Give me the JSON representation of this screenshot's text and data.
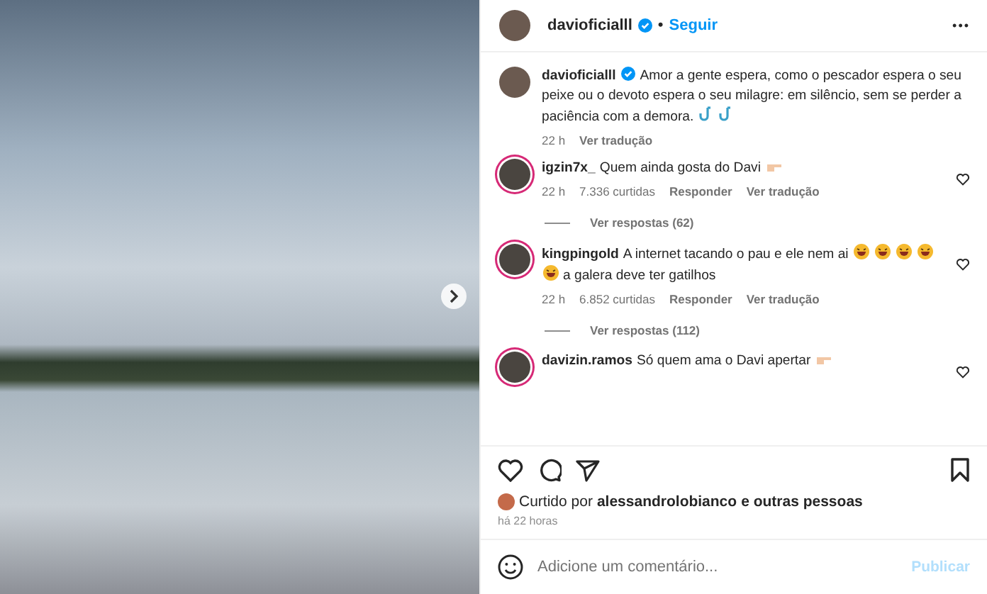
{
  "header": {
    "username": "davioficialll",
    "verified": true,
    "separator": "•",
    "follow": "Seguir",
    "more": "•••"
  },
  "caption": {
    "username": "davioficialll",
    "verified": true,
    "segments": [
      {
        "kind": "text",
        "text": "Amor a gente espera, como o pescador espera o seu peixe ou o devoto espera o seu milagre: em silêncio, sem se perder a paciência com a demora."
      },
      {
        "kind": "hook"
      },
      {
        "kind": "hook"
      }
    ],
    "time": "22 h",
    "translate": "Ver tradução"
  },
  "comments": [
    {
      "username": "igzin7x_",
      "segments": [
        {
          "kind": "text",
          "text": "Quem ainda gosta do Davi"
        },
        {
          "kind": "point"
        }
      ],
      "meta": [
        {
          "kind": "text",
          "text": "22 h"
        },
        {
          "kind": "text",
          "text": "7.336 curtidas"
        },
        {
          "kind": "link",
          "text": "Responder"
        },
        {
          "kind": "link",
          "text": "Ver tradução"
        }
      ],
      "replies": "Ver respostas (62)"
    },
    {
      "username": "kingpingold",
      "segments": [
        {
          "kind": "text",
          "text": "A internet tacando o pau e ele nem ai"
        },
        {
          "kind": "laugh"
        },
        {
          "kind": "laugh"
        },
        {
          "kind": "laugh"
        },
        {
          "kind": "laugh"
        },
        {
          "kind": "laugh"
        },
        {
          "kind": "text",
          "text": "a galera deve ter gatilhos"
        }
      ],
      "meta": [
        {
          "kind": "text",
          "text": "22 h"
        },
        {
          "kind": "text",
          "text": "6.852 curtidas"
        },
        {
          "kind": "link",
          "text": "Responder"
        },
        {
          "kind": "link",
          "text": "Ver tradução"
        }
      ],
      "replies": "Ver respostas (112)"
    },
    {
      "username": "davizin.ramos",
      "segments": [
        {
          "kind": "text",
          "text": "Só quem ama o Davi apertar"
        },
        {
          "kind": "point"
        }
      ]
    }
  ],
  "likes": {
    "prefix": "Curtido por",
    "user": "alessandrolobianco",
    "suffix": "e outras pessoas",
    "time": "há 22 horas"
  },
  "composer": {
    "placeholder": "Adicione um comentário...",
    "submit": "Publicar",
    "disabled": true
  }
}
